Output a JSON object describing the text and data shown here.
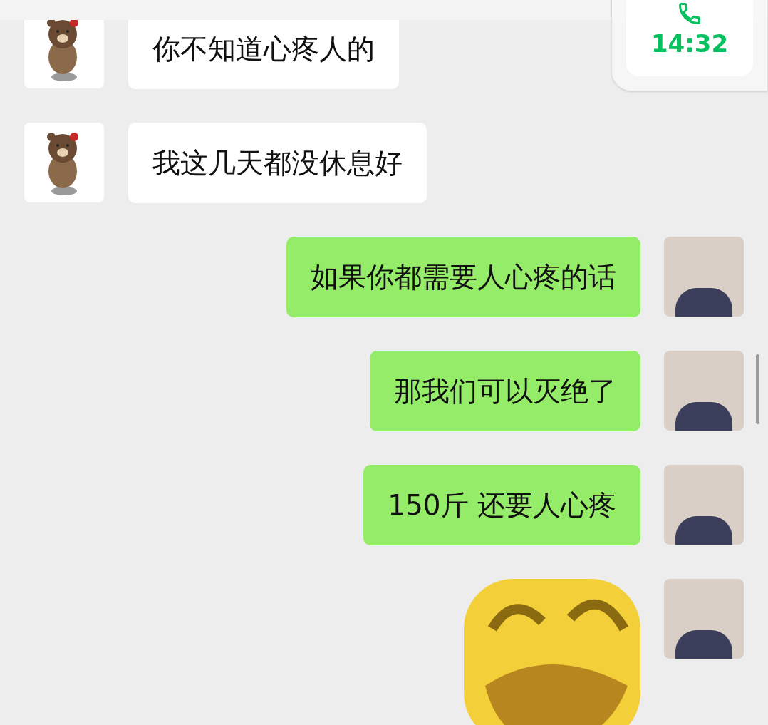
{
  "call_widget": {
    "time": "14:32"
  },
  "messages": [
    {
      "outgoing": false,
      "kind": "text",
      "text": "你不知道心疼人的"
    },
    {
      "outgoing": false,
      "kind": "text",
      "text": "我这几天都没休息好"
    },
    {
      "outgoing": true,
      "kind": "text",
      "text": "如果你都需要人心疼的话"
    },
    {
      "outgoing": true,
      "kind": "text",
      "text": "那我们可以灭绝了"
    },
    {
      "outgoing": true,
      "kind": "text",
      "text": "150斤 还要人心疼"
    },
    {
      "outgoing": true,
      "kind": "sticker"
    }
  ]
}
